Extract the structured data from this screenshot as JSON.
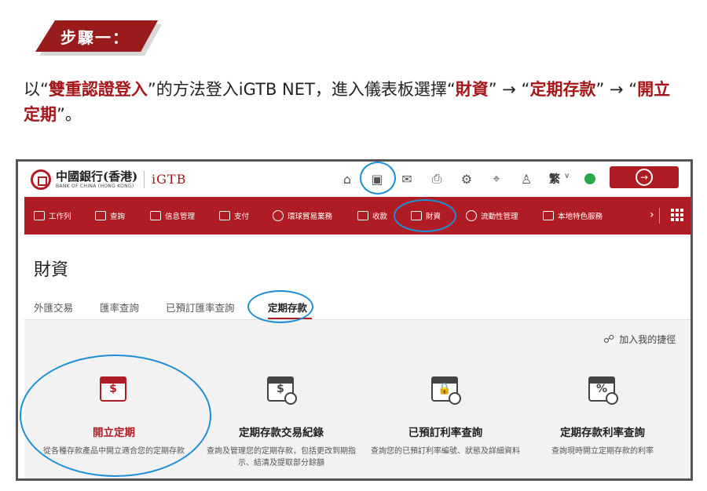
{
  "step": {
    "label": "步驟一："
  },
  "instruction": {
    "p1": "以“",
    "login_method": "雙重認證登入",
    "p2": "”的方法登入iGTB NET，進入儀表板選擇“",
    "menu_wealth": "財資",
    "p3": "” → “",
    "menu_deposit": "定期存款",
    "p4": "” → “",
    "menu_open": "開立定期",
    "p5": "”。"
  },
  "topbar": {
    "logo_text": "中國銀行(香港)",
    "logo_sub": "BANK OF CHINA (HONG KONG)",
    "product": "iGTB",
    "language": "繁",
    "icons": [
      "home-icon",
      "dashboard-icon",
      "mail-icon",
      "print-icon",
      "settings-icon",
      "location-icon",
      "user-icon",
      "status-icon",
      "logout-icon"
    ]
  },
  "nav": {
    "items": [
      {
        "label": "工作列",
        "icon": "briefcase-icon"
      },
      {
        "label": "查詢",
        "icon": "search-icon"
      },
      {
        "label": "信息管理",
        "icon": "folder-icon"
      },
      {
        "label": "支付",
        "icon": "payment-icon"
      },
      {
        "label": "環球貿易業務",
        "icon": "globe-icon"
      },
      {
        "label": "收款",
        "icon": "collection-icon"
      },
      {
        "label": "財資",
        "icon": "treasury-icon"
      },
      {
        "label": "流動性管理",
        "icon": "liquidity-icon"
      },
      {
        "label": "本地特色服務",
        "icon": "bank-icon"
      }
    ],
    "next": "›"
  },
  "page": {
    "title": "財資",
    "tabs": [
      {
        "label": "外匯交易",
        "active": false
      },
      {
        "label": "匯率查詢",
        "active": false
      },
      {
        "label": "已預訂匯率查詢",
        "active": false
      },
      {
        "label": "定期存款",
        "active": true
      }
    ],
    "bookmark": "加入我的捷徑"
  },
  "cards": [
    {
      "title": "開立定期",
      "desc": "從各種存款產品中開立適合您的定期存款",
      "icon": "calendar-dollar-icon",
      "highlighted": true
    },
    {
      "title": "定期存款交易紀錄",
      "desc": "查詢及管理您的定期存款，包括更改到期指示、結清及提取部分餘額",
      "icon": "calendar-dollar-search-icon",
      "highlighted": false
    },
    {
      "title": "已預訂利率查詢",
      "desc": "查詢您的已預訂利率編號、狀態及詳細資料",
      "icon": "calendar-lock-search-icon",
      "highlighted": false
    },
    {
      "title": "定期存款利率查詢",
      "desc": "查詢現時開立定期存款的利率",
      "icon": "calendar-percent-search-icon",
      "highlighted": false
    }
  ],
  "colors": {
    "brand_red": "#b01c23",
    "highlight_blue": "#1e8fd6",
    "banner_red": "#9a1b1b"
  }
}
